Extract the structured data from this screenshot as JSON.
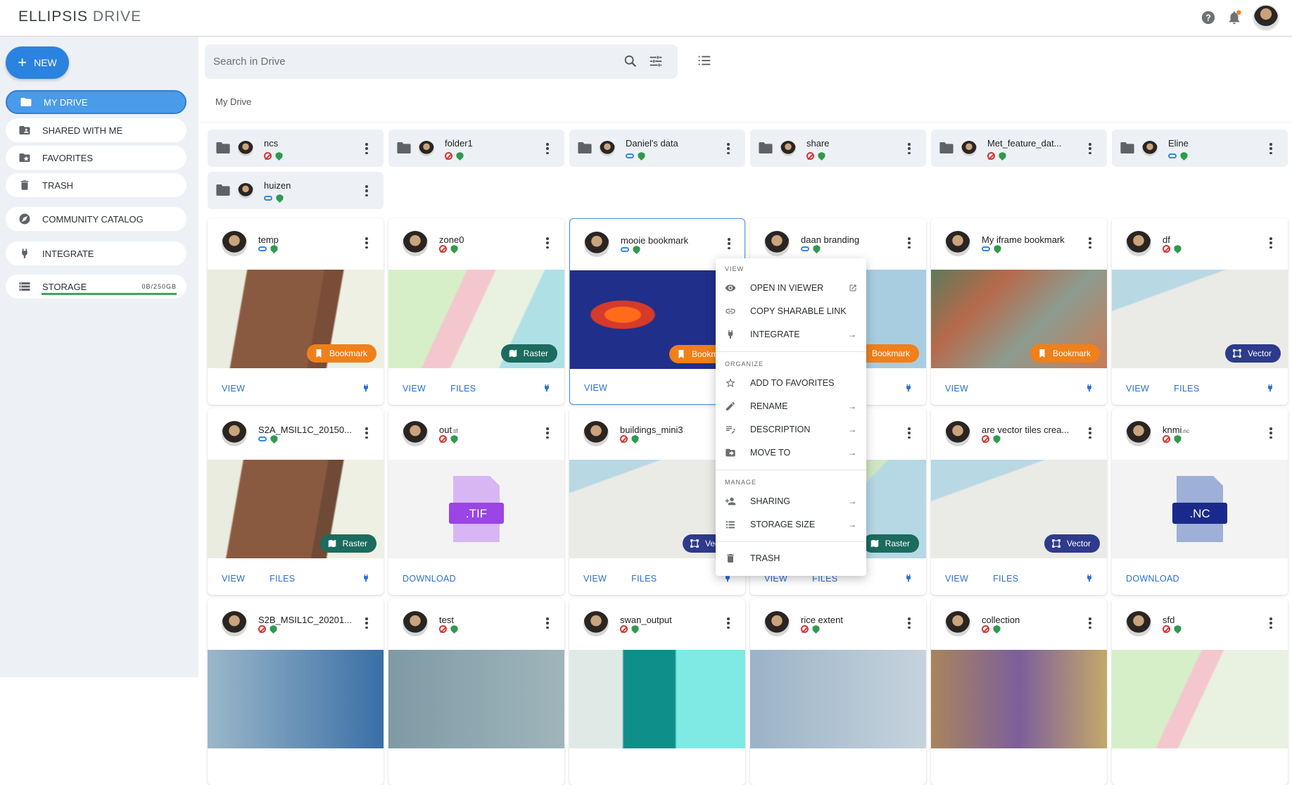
{
  "app": {
    "logo_text": "ELLIPSIS",
    "logo_sub": "DRIVE",
    "accent": "#2b83e0"
  },
  "header": {
    "help_icon": "help-icon",
    "notification_icon": "bell-icon"
  },
  "sidebar": {
    "new_label": "NEW",
    "items": [
      {
        "label": "MY DRIVE",
        "icon": "folder-icon",
        "active": true
      },
      {
        "label": "SHARED WITH ME",
        "icon": "shared-folder-icon"
      },
      {
        "label": "FAVORITES",
        "icon": "star-folder-icon"
      },
      {
        "label": "TRASH",
        "icon": "trash-icon"
      },
      {
        "label": "COMMUNITY CATALOG",
        "icon": "compass-icon"
      },
      {
        "label": "INTEGRATE",
        "icon": "plug-icon"
      },
      {
        "label": "STORAGE",
        "icon": "storage-icon"
      }
    ],
    "storage_value": "0B/250GB",
    "storage_fill": 1
  },
  "search": {
    "placeholder": "Search in Drive"
  },
  "breadcrumb": "My Drive",
  "folders": [
    {
      "name": "ncs",
      "share": "private"
    },
    {
      "name": "folder1",
      "share": "private"
    },
    {
      "name": "Daniel's data",
      "share": "link"
    },
    {
      "name": "share",
      "share": "private"
    },
    {
      "name": "Met_feature_dat...",
      "share": "private"
    },
    {
      "name": "Eline",
      "share": "link"
    },
    {
      "name": "huizen",
      "share": "link"
    }
  ],
  "cards": [
    {
      "name": "temp",
      "ext": "",
      "share": "link",
      "type": "Bookmark",
      "actions": [
        "VIEW"
      ],
      "plug": true
    },
    {
      "name": "zone0",
      "ext": "",
      "share": "private",
      "type": "Raster",
      "actions": [
        "VIEW",
        "FILES"
      ],
      "plug": true
    },
    {
      "name": "mooie bookmark",
      "ext": "",
      "share": "link",
      "type": "Bookmark",
      "actions": [
        "VIEW"
      ],
      "plug": false
    },
    {
      "name": "daan branding",
      "ext": "",
      "share": "link",
      "type": "Bookmark",
      "actions": [],
      "plug": true
    },
    {
      "name": "My iframe bookmark",
      "ext": "",
      "share": "link",
      "type": "Bookmark",
      "actions": [
        "VIEW"
      ],
      "plug": true
    },
    {
      "name": "df",
      "ext": "",
      "share": "private",
      "type": "Vector",
      "actions": [
        "VIEW",
        "FILES"
      ],
      "plug": true
    },
    {
      "name": "S2A_MSIL1C_20150...",
      "ext": "",
      "share": "link",
      "type": "Raster",
      "actions": [
        "VIEW",
        "FILES"
      ],
      "plug": true
    },
    {
      "name": "out",
      "ext": ".tif",
      "share": "private",
      "type": "",
      "actions": [
        "DOWNLOAD"
      ],
      "plug": false,
      "file_label": ".TIF"
    },
    {
      "name": "buildings_mini3",
      "ext": "",
      "share": "private",
      "type": "Vector",
      "actions": [
        "VIEW",
        "FILES"
      ],
      "plug": true
    },
    {
      "name": "",
      "ext": "",
      "share": "private",
      "type": "Raster",
      "actions": [
        "VIEW",
        "FILES"
      ],
      "plug": true
    },
    {
      "name": "are vector tiles crea...",
      "ext": "",
      "share": "private",
      "type": "Vector",
      "actions": [
        "VIEW",
        "FILES"
      ],
      "plug": true
    },
    {
      "name": "knmi",
      "ext": ".nc",
      "share": "private",
      "type": "",
      "actions": [
        "DOWNLOAD"
      ],
      "plug": false,
      "file_label": ".NC"
    },
    {
      "name": "S2B_MSIL1C_20201...",
      "ext": "",
      "share": "private",
      "type": "",
      "actions": [],
      "plug": false
    },
    {
      "name": "test",
      "ext": "",
      "share": "private",
      "type": "",
      "actions": [],
      "plug": false
    },
    {
      "name": "swan_output",
      "ext": "",
      "share": "private",
      "type": "",
      "actions": [],
      "plug": false
    },
    {
      "name": "rice extent",
      "ext": "",
      "share": "private",
      "type": "",
      "actions": [],
      "plug": false
    },
    {
      "name": "collection",
      "ext": "",
      "share": "private",
      "type": "",
      "actions": [],
      "plug": false
    },
    {
      "name": "sfd",
      "ext": "",
      "share": "private",
      "type": "",
      "actions": [],
      "plug": false
    }
  ],
  "context_menu": {
    "view_section": "VIEW",
    "organize_section": "ORGANIZE",
    "manage_section": "MANAGE",
    "items": [
      {
        "label": "OPEN IN VIEWER",
        "icon": "eye-icon",
        "suffix": "external"
      },
      {
        "label": "COPY SHARABLE LINK",
        "icon": "link-icon",
        "suffix": ""
      },
      {
        "label": "INTEGRATE",
        "icon": "plug-icon",
        "suffix": "→"
      },
      {
        "label": "ADD TO FAVORITES",
        "icon": "star-icon",
        "suffix": ""
      },
      {
        "label": "RENAME",
        "icon": "pencil-icon",
        "suffix": "→"
      },
      {
        "label": "DESCRIPTION",
        "icon": "description-icon",
        "suffix": "→"
      },
      {
        "label": "MOVE TO",
        "icon": "move-folder-icon",
        "suffix": "→"
      },
      {
        "label": "SHARING",
        "icon": "person-add-icon",
        "suffix": "→"
      },
      {
        "label": "STORAGE SIZE",
        "icon": "list-icon",
        "suffix": "→"
      },
      {
        "label": "TRASH",
        "icon": "trash-icon",
        "suffix": ""
      }
    ]
  }
}
